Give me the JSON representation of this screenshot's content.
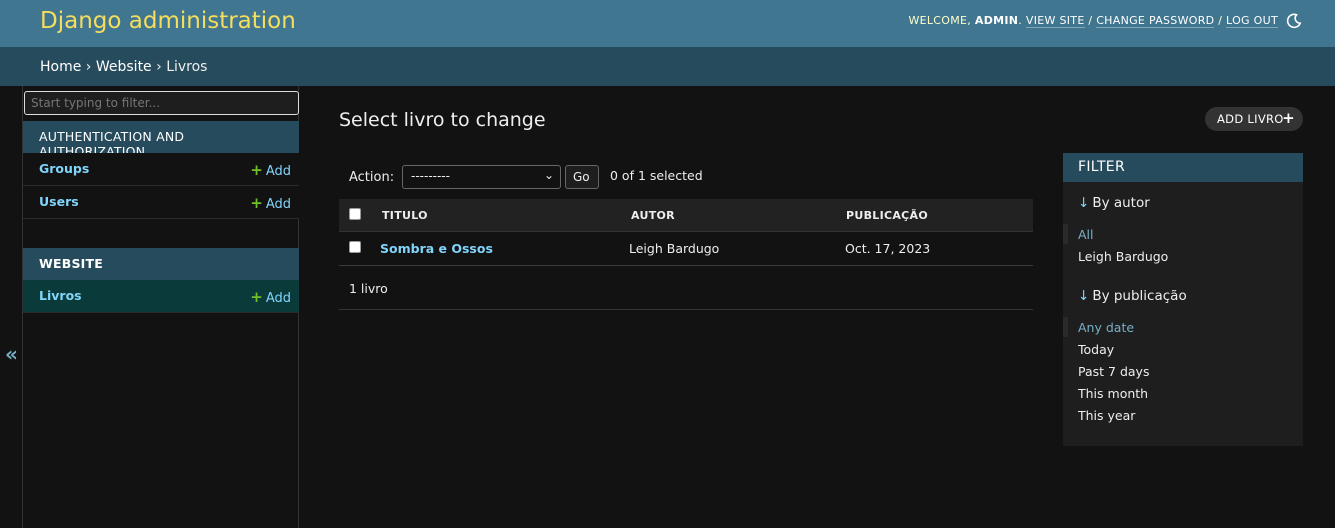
{
  "header": {
    "title": "Django administration",
    "welcome": "WELCOME,",
    "user": "ADMIN",
    "view_site": "VIEW SITE",
    "change_password": "CHANGE PASSWORD",
    "log_out": "LOG OUT",
    "sep": "/",
    "theme_icon": "moon-icon"
  },
  "breadcrumbs": {
    "home": "Home",
    "website": "Website",
    "current": "Livros",
    "separator": "›"
  },
  "sidebar": {
    "filter_placeholder": "Start typing to filter...",
    "apps": [
      {
        "caption": "AUTHENTICATION AND AUTHORIZATION",
        "models": [
          {
            "name": "Groups",
            "add": "Add"
          },
          {
            "name": "Users",
            "add": "Add"
          }
        ]
      },
      {
        "caption": "WEBSITE",
        "models": [
          {
            "name": "Livros",
            "add": "Add"
          }
        ]
      }
    ],
    "collapse_toggle": "«"
  },
  "main": {
    "title": "Select livro to change",
    "add_button": "ADD LIVRO",
    "actions": {
      "label": "Action:",
      "selected_value": "---------",
      "go": "Go",
      "counter": "0 of 1 selected"
    },
    "table": {
      "columns": [
        "TITULO",
        "AUTOR",
        "PUBLICAÇÃO"
      ],
      "rows": [
        {
          "titulo": "Sombra e Ossos",
          "autor": "Leigh Bardugo",
          "publicacao": "Oct. 17, 2023"
        }
      ]
    },
    "paginator": "1 livro"
  },
  "filter": {
    "heading": "FILTER",
    "groups": [
      {
        "title": "By autor",
        "options": [
          "All",
          "Leigh Bardugo"
        ],
        "selected": "All"
      },
      {
        "title": "By publicação",
        "options": [
          "Any date",
          "Today",
          "Past 7 days",
          "This month",
          "This year"
        ],
        "selected": "Any date"
      }
    ]
  },
  "colors": {
    "header_bg": "#417690",
    "breadcrumbs_bg": "#264b5d",
    "branding": "#f5dd5d",
    "link": "#81d4fa",
    "add_plus": "#70bf2b",
    "body_bg": "#121212"
  }
}
